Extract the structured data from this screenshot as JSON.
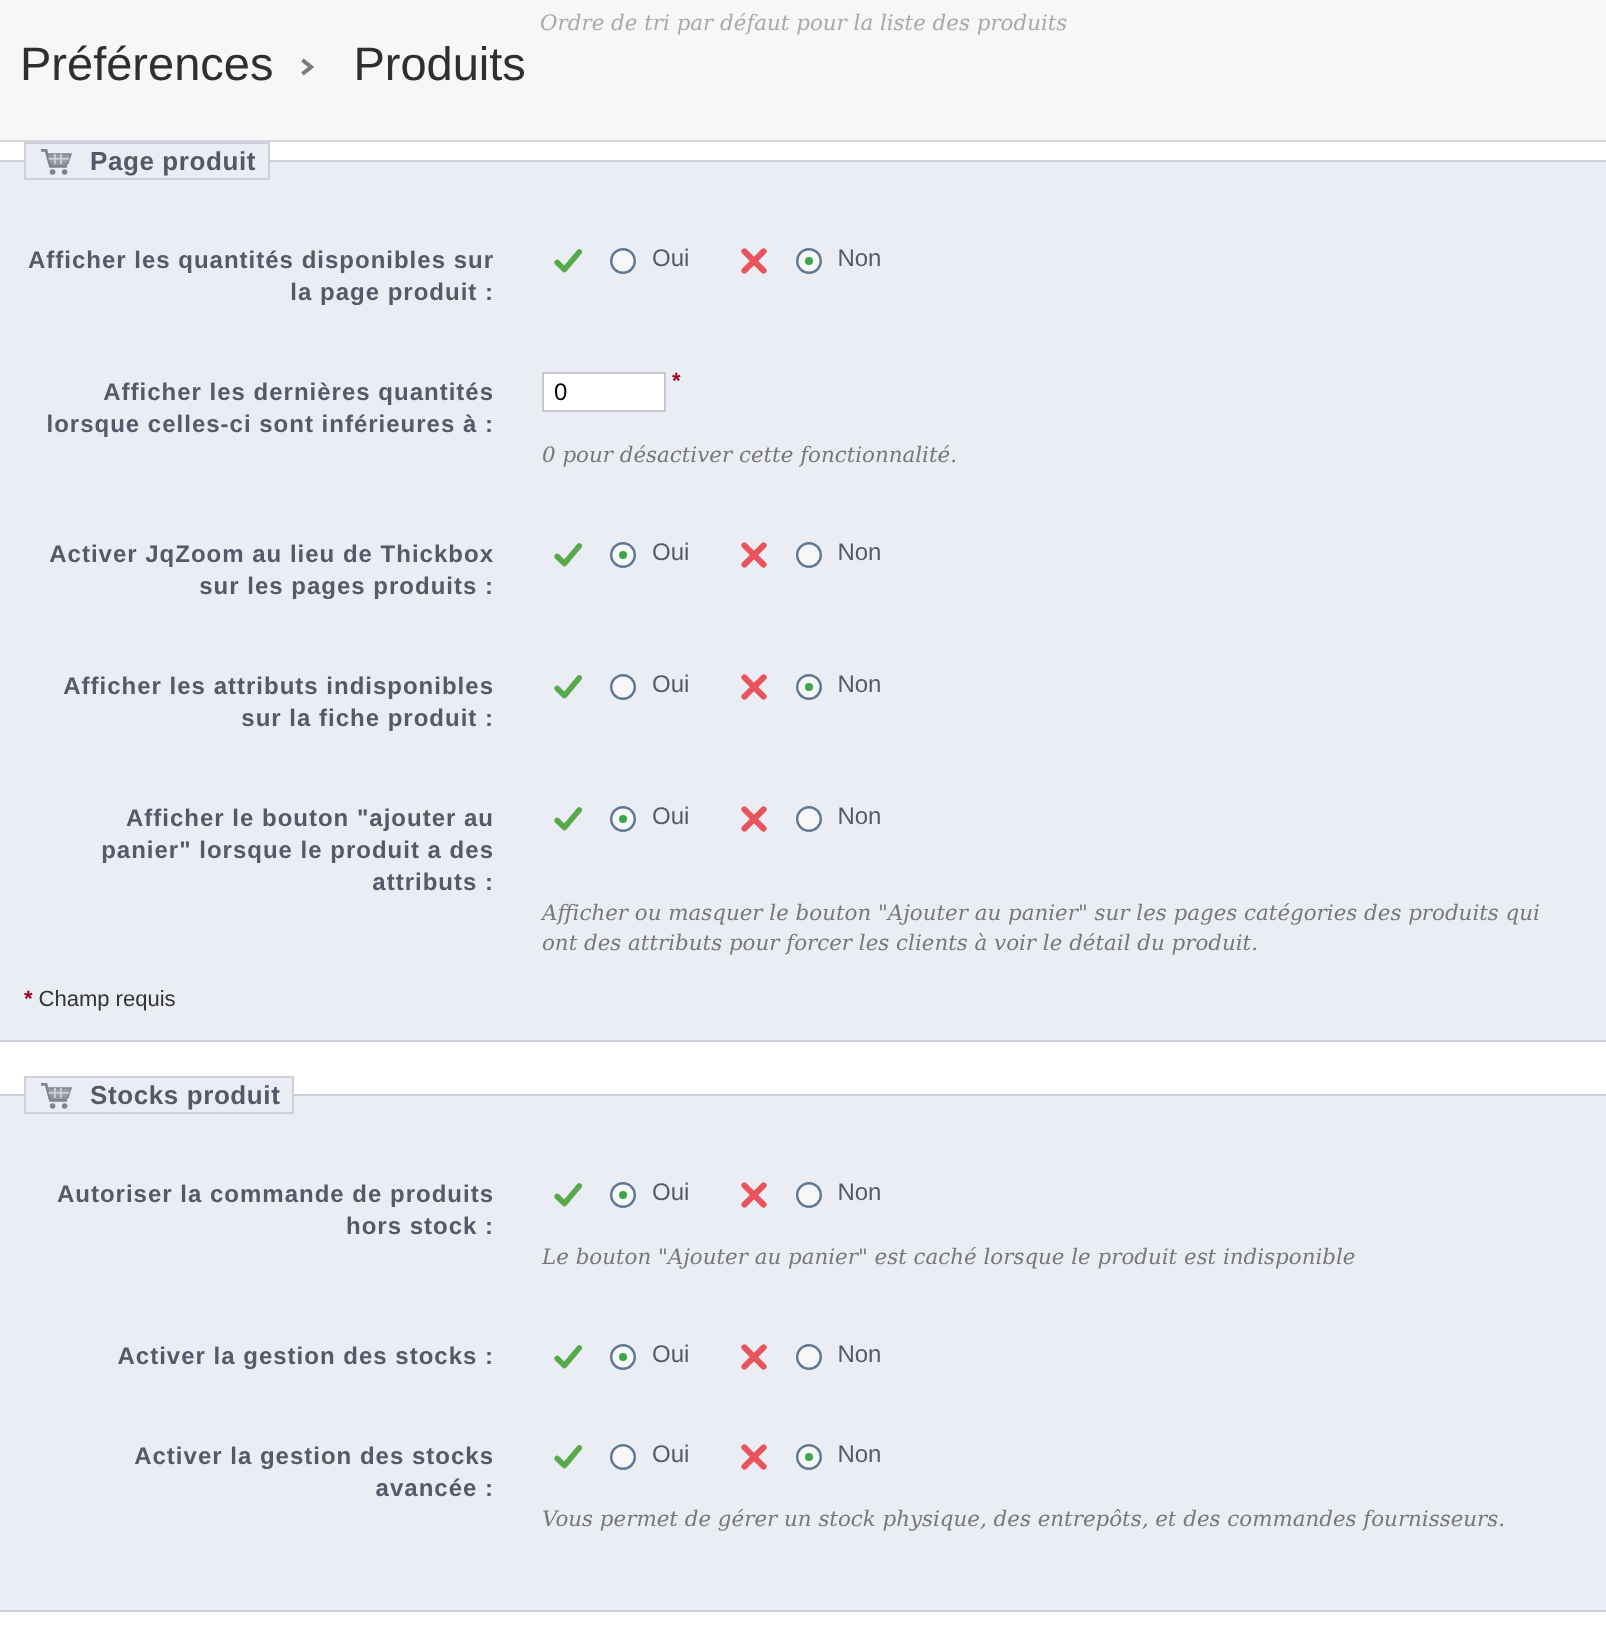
{
  "header": {
    "faded_text": "Ordre de tri par défaut pour la liste des produits",
    "breadcrumb": [
      "Préférences",
      "Produits"
    ]
  },
  "sections": [
    {
      "legend": "Page produit",
      "fields": [
        {
          "kind": "toggle",
          "label": [
            "Afficher les quantités disponibles sur",
            "la page produit :"
          ],
          "options": [
            {
              "kind": "yes",
              "label": "Oui",
              "selected": false
            },
            {
              "kind": "no",
              "label": "Non",
              "selected": true
            }
          ]
        },
        {
          "kind": "number",
          "label": [
            "Afficher les dernières quantités",
            "lorsque celles-ci sont inférieures à :"
          ],
          "value": "0",
          "required_mark": "*",
          "hint": [
            "0 pour désactiver cette fonctionnalité."
          ]
        },
        {
          "kind": "toggle",
          "label": [
            "Activer JqZoom au lieu de Thickbox",
            "sur les pages produits :"
          ],
          "options": [
            {
              "kind": "yes",
              "label": "Oui",
              "selected": true
            },
            {
              "kind": "no",
              "label": "Non",
              "selected": false
            }
          ]
        },
        {
          "kind": "toggle",
          "label": [
            "Afficher les attributs indisponibles",
            "sur la fiche produit :"
          ],
          "options": [
            {
              "kind": "yes",
              "label": "Oui",
              "selected": false
            },
            {
              "kind": "no",
              "label": "Non",
              "selected": true
            }
          ]
        },
        {
          "kind": "toggle",
          "label": [
            "Afficher le bouton \"ajouter au",
            "panier\" lorsque le produit a des",
            "attributs :"
          ],
          "options": [
            {
              "kind": "yes",
              "label": "Oui",
              "selected": true
            },
            {
              "kind": "no",
              "label": "Non",
              "selected": false
            }
          ],
          "hint": [
            "Afficher ou masquer le bouton \"Ajouter au panier\" sur les pages catégories des produits qui",
            "ont des attributs pour forcer les clients à voir le détail du produit."
          ]
        }
      ],
      "footnote": {
        "mark": "*",
        "text": "Champ requis"
      }
    },
    {
      "legend": "Stocks produit",
      "fields": [
        {
          "kind": "toggle",
          "label": [
            "Autoriser la commande de produits",
            "hors stock :"
          ],
          "options": [
            {
              "kind": "yes",
              "label": "Oui",
              "selected": true
            },
            {
              "kind": "no",
              "label": "Non",
              "selected": false
            }
          ],
          "hint": [
            "Le bouton \"Ajouter au panier\" est caché lorsque le produit est indisponible"
          ]
        },
        {
          "kind": "toggle",
          "label": [
            "Activer la gestion des stocks :"
          ],
          "options": [
            {
              "kind": "yes",
              "label": "Oui",
              "selected": true
            },
            {
              "kind": "no",
              "label": "Non",
              "selected": false
            }
          ]
        },
        {
          "kind": "toggle",
          "label": [
            "Activer la gestion des stocks",
            "avancée :"
          ],
          "options": [
            {
              "kind": "yes",
              "label": "Oui",
              "selected": false
            },
            {
              "kind": "no",
              "label": "Non",
              "selected": true
            }
          ],
          "hint": [
            "Vous permet de gérer un stock physique, des entrepôts, et des commandes fournisseurs."
          ]
        }
      ]
    }
  ]
}
